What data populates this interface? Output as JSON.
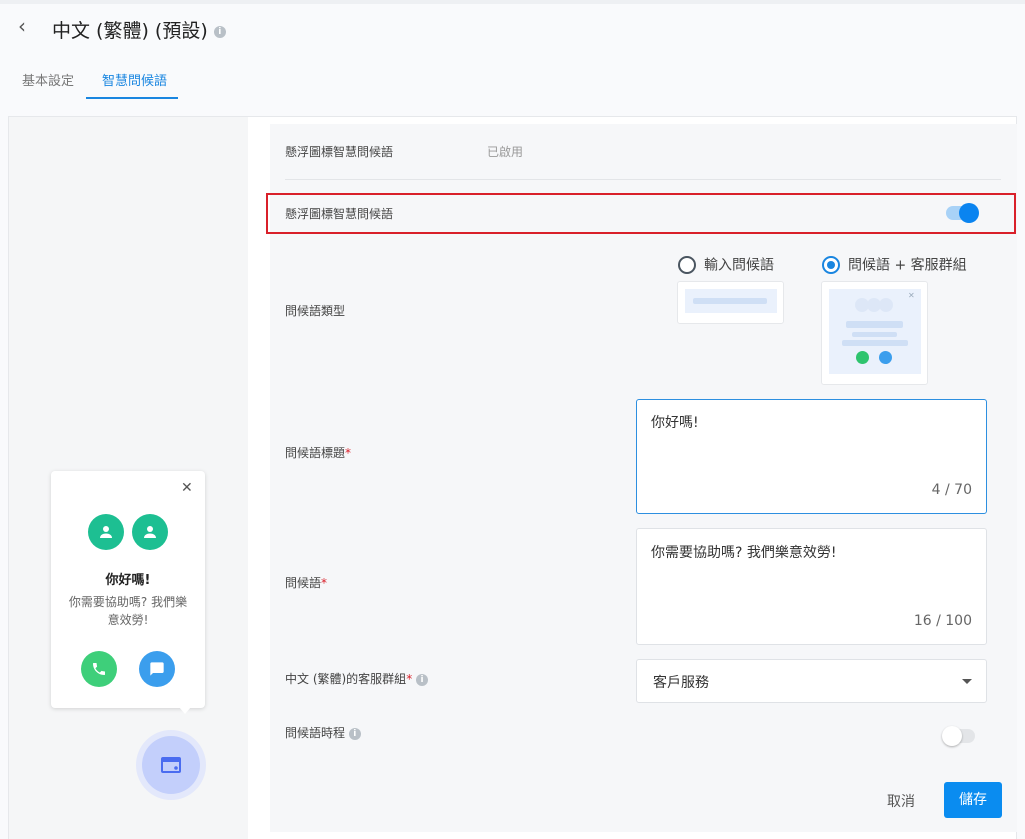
{
  "header": {
    "back_icon": "chevron-left-icon",
    "title": "中文 (繁體) (預設)",
    "info_icon": "info-icon"
  },
  "tabs": [
    {
      "label": "基本設定",
      "active": false
    },
    {
      "label": "智慧問候語",
      "active": true
    }
  ],
  "settings": {
    "status_label": "懸浮圖標智慧問候語",
    "status_value": "已啟用",
    "toggle_label": "懸浮圖標智慧問候語",
    "toggle_on": true,
    "type_label": "問候語類型",
    "type_options": [
      {
        "label": "輸入問候語",
        "selected": false
      },
      {
        "label": "問候語 + 客服群組",
        "selected": true
      }
    ],
    "title_label": "問候語標題",
    "title_value": "你好嗎!",
    "title_count": "4 / 70",
    "message_label": "問候語",
    "message_value": "你需要協助嗎? 我們樂意效勞!",
    "message_count": "16 / 100",
    "group_label": "中文 (繁體)的客服群組",
    "group_value": "客戶服務",
    "schedule_label": "問候語時程",
    "schedule_on": false,
    "required_mark": "*"
  },
  "actions": {
    "cancel": "取消",
    "save": "儲存"
  },
  "preview": {
    "title": "你好嗎!",
    "message": "你需要協助嗎? 我們樂意效勞!"
  },
  "colors": {
    "accent": "#1a86e0",
    "highlight": "#d9202a",
    "agent": "#1dbf92",
    "phone": "#3ecf7a",
    "chat": "#3b9eed"
  }
}
